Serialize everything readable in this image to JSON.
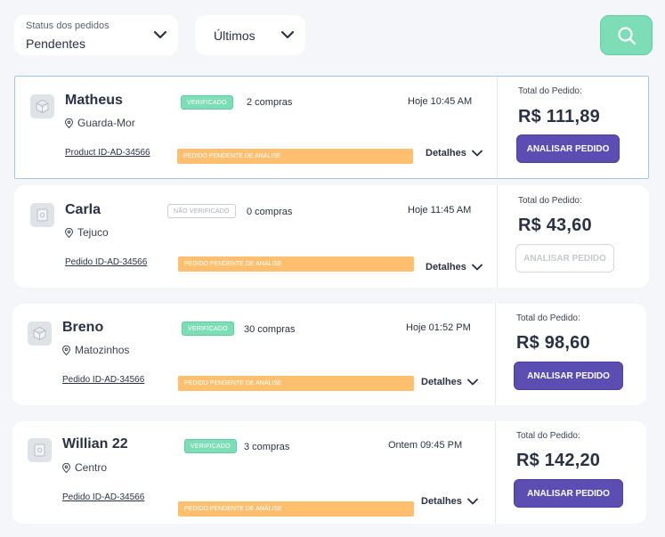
{
  "filters": {
    "status_label": "Status dos pedidos",
    "status_value": "Pendentes",
    "period_value": "Últimos"
  },
  "colors": {
    "accent_green": "#7dddb6",
    "primary_purple": "#5c4db2",
    "pending_orange": "#ffbf6e"
  },
  "orders": [
    {
      "name": "Matheus",
      "location": "Guarda-Mor",
      "badge": "VERIFICADO",
      "purchases": "2 compras",
      "time": "Hoje 10:45 AM",
      "order_id": "Product ID-AD-34566",
      "status": "PEDIDO PENDENTE DE ANÁLISE",
      "details": "Detalhes",
      "total_label": "Total do Pedido:",
      "total": "R$ 111,89",
      "action": "ANALISAR PEDIDO"
    },
    {
      "name": "Carla",
      "location": "Tejuco",
      "badge": "NÃO VERIFICADO",
      "purchases": "0 compras",
      "time": "Hoje 11:45 AM",
      "order_id": "Pedido ID-AD-34566",
      "status": "PEDIDO PENDENTE DE ANÁLISE",
      "details": "Detalhes",
      "total_label": "Total do Pedido:",
      "total": "R$ 43,60",
      "action": "ANALISAR PEDIDO"
    },
    {
      "name": "Breno",
      "location": "Matozinhos",
      "badge": "VERIFICADO",
      "purchases": "30 compras",
      "time": "Hoje 01:52 PM",
      "order_id": "Pedido ID-AD-34566",
      "status": "PEDIDO PENDENTE DE ANÁLISE",
      "details": "Detalhes",
      "total_label": "Total do Pedido:",
      "total": "R$ 98,60",
      "action": "ANALISAR PEDIDO"
    },
    {
      "name": "Willian 22",
      "location": "Centro",
      "badge": "VERIFICADO",
      "purchases": "3 compras",
      "time": "Ontem 09:45 PM",
      "order_id": "Pedido ID-AD-34566",
      "status": "PEDIDO PENDENTE DE ANÁLISE",
      "details": "Detalhes",
      "total_label": "Total do Pedido:",
      "total": "R$ 142,20",
      "action": "ANALISAR PEDIDO"
    }
  ]
}
